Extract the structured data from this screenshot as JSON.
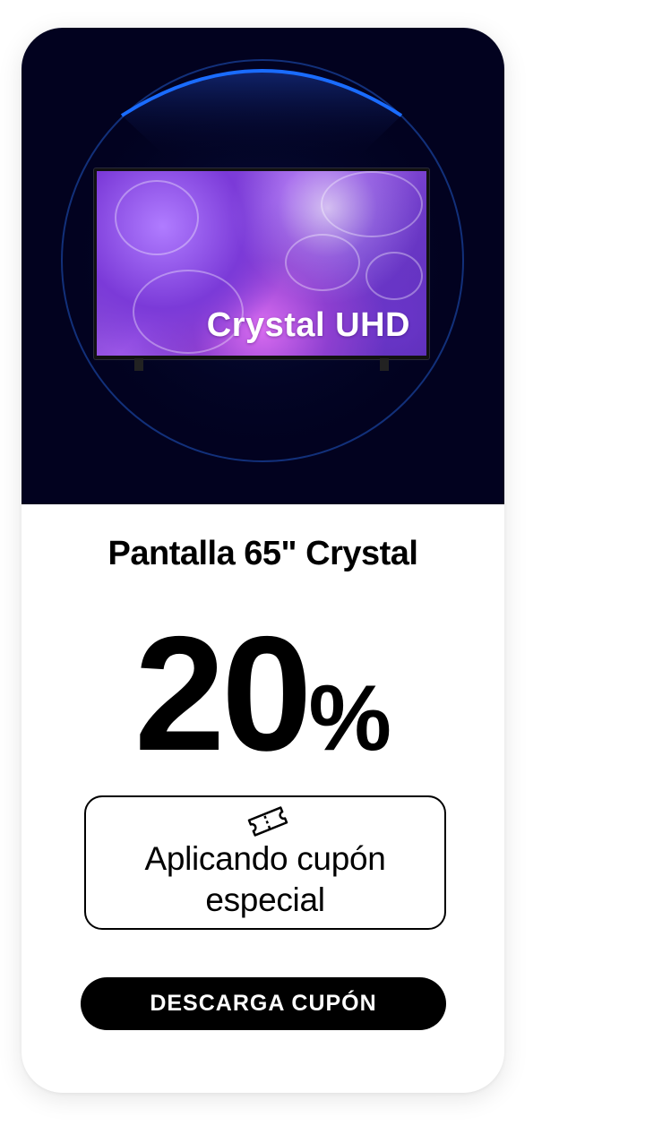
{
  "hero": {
    "image": "samsung-crystal-uhd-tv",
    "tv_overlay_text": "Crystal UHD",
    "background_color": "#02021f",
    "ring_color": "#1a6cff"
  },
  "product": {
    "title": "Pantalla 65\" Crystal"
  },
  "discount": {
    "value": "20",
    "symbol": "%"
  },
  "coupon": {
    "icon": "ticket-icon",
    "text_line1": "Aplicando cupón",
    "text_line2": "especial"
  },
  "cta": {
    "label": "DESCARGA CUPÓN"
  }
}
